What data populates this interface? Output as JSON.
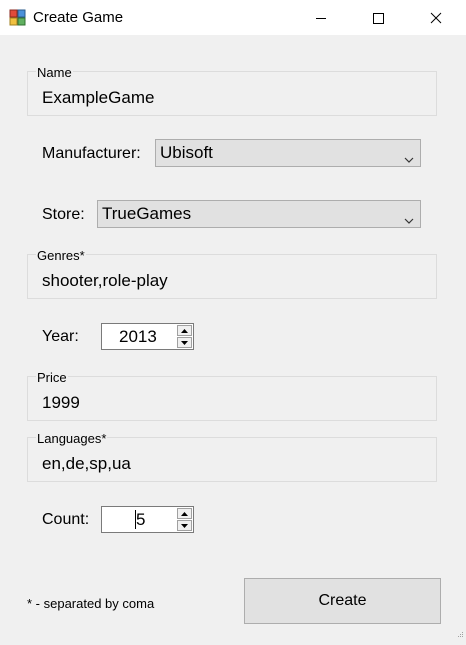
{
  "window": {
    "title": "Create Game",
    "icon": "application-icon",
    "controls": [
      "minimize-icon",
      "maximize-icon",
      "close-icon"
    ]
  },
  "form": {
    "name": {
      "label": "Name",
      "value": "ExampleGame"
    },
    "manufacturer": {
      "label": "Manufacturer:",
      "selected": "Ubisoft"
    },
    "store": {
      "label": "Store:",
      "selected": "TrueGames"
    },
    "genres": {
      "label": "Genres*",
      "value": "shooter,role-play"
    },
    "year": {
      "label": "Year:",
      "value": "2013"
    },
    "price": {
      "label": "Price",
      "value": "1999"
    },
    "languages": {
      "label": "Languages*",
      "value": "en,de,sp,ua"
    },
    "count": {
      "label": "Count:",
      "value": "5"
    }
  },
  "footer": {
    "note": "* - separated by coma",
    "create_label": "Create"
  },
  "colors": {
    "titlebar": "#ffffff",
    "window_bg": "#f0f0f0",
    "button_bg": "#e1e1e1",
    "border": "#adadad"
  }
}
